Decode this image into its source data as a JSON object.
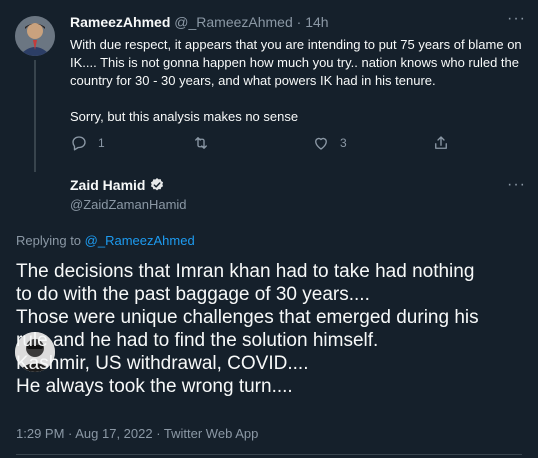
{
  "reply_tweet": {
    "display_name": "RameezAhmed",
    "handle": "@_RameezAhmed",
    "separator": "·",
    "time": "14h",
    "paragraphs": [
      "With due respect, it appears that you are intending to put 75 years of blame on IK.... This is not gonna happen how much you try.. nation knows who ruled the country for 30 - 30 years, and what powers IK had in his tenure.",
      "Sorry, but this analysis makes no sense"
    ],
    "reply_count": "1",
    "retweet_count": "",
    "like_count": "3",
    "more_icon": "ellipsis-icon"
  },
  "main_tweet": {
    "display_name": "Zaid Hamid",
    "handle": "@ZaidZamanHamid",
    "verified": true,
    "replying_prefix": "Replying to",
    "replying_to": "@_RameezAhmed",
    "lines": [
      "The decisions that Imran khan had to take had nothing",
      "to do with the past baggage of 30 years....",
      "Those were unique challenges that emerged during his",
      "rule and he had to find the solution himself.",
      "Kashmir, US withdrawal, COVID....",
      "He always took the wrong turn...."
    ],
    "timestamp": "1:29 PM · Aug 17, 2022 · Twitter Web App"
  },
  "colors": {
    "background": "#15202b",
    "text": "#f7f9f9",
    "muted": "#8b98a5",
    "link": "#1d9bf0",
    "border": "#38444d"
  }
}
